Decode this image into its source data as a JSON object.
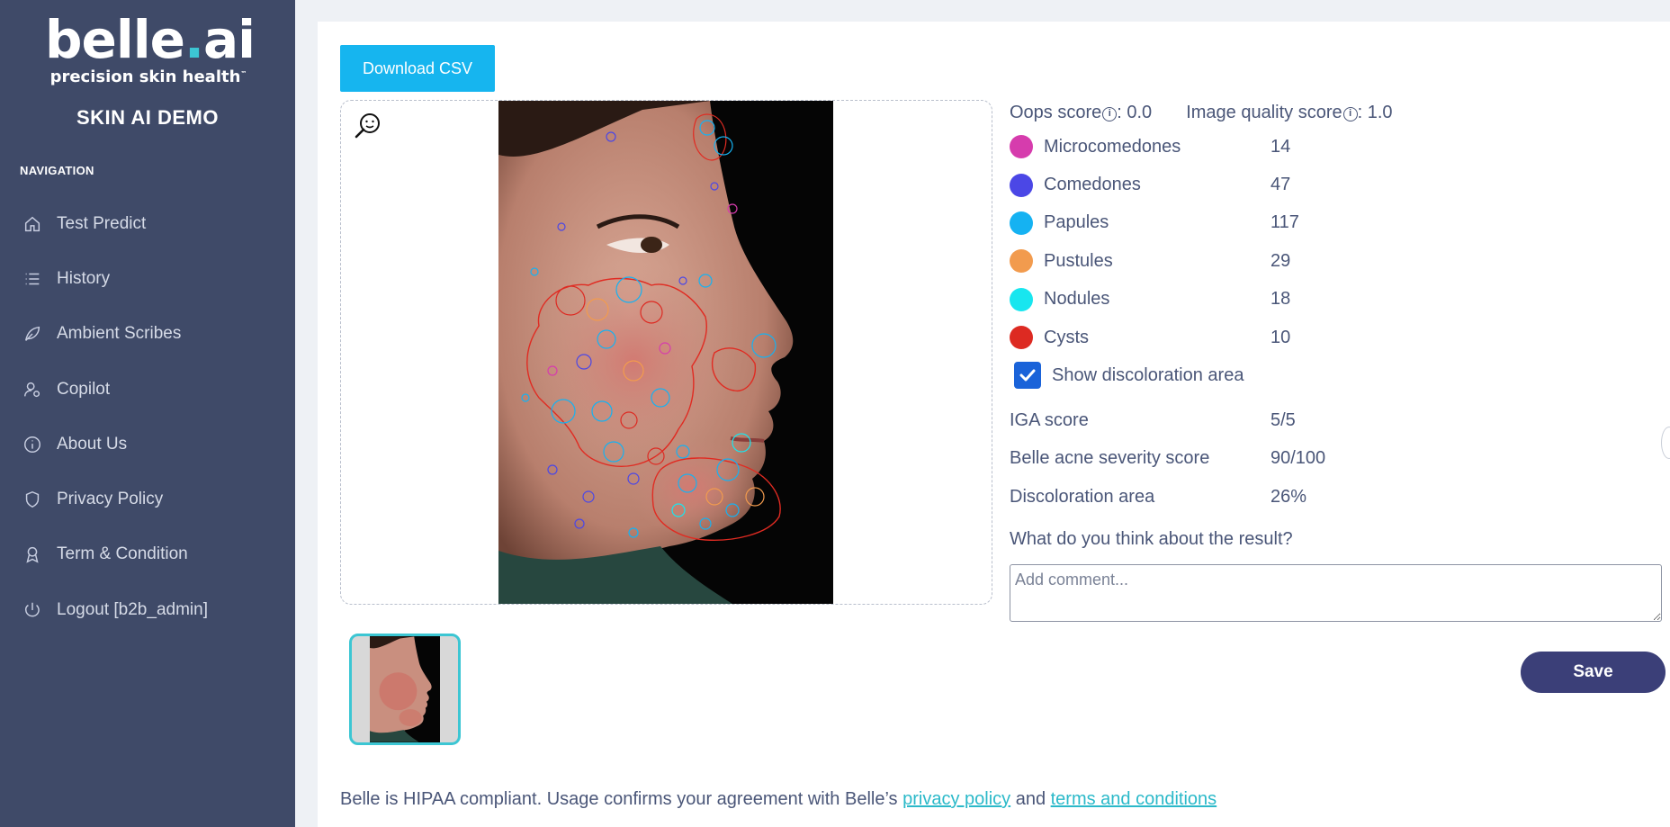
{
  "brand": {
    "logo_main": "belle",
    "logo_dot": ".",
    "logo_tld": "ai",
    "tagline": "precision skin health",
    "tm": "™",
    "app_title": "SKIN AI DEMO"
  },
  "sidebar": {
    "heading": "NAVIGATION",
    "items": [
      {
        "label": "Test Predict",
        "icon": "home-icon"
      },
      {
        "label": "History",
        "icon": "list-icon"
      },
      {
        "label": "Ambient Scribes",
        "icon": "leaf-icon"
      },
      {
        "label": "Copilot",
        "icon": "user-gear-icon"
      },
      {
        "label": "About Us",
        "icon": "info-circle-icon"
      },
      {
        "label": "Privacy Policy",
        "icon": "shield-icon"
      },
      {
        "label": "Term & Condition",
        "icon": "award-icon"
      },
      {
        "label": "Logout [b2b_admin]",
        "icon": "power-icon"
      }
    ]
  },
  "toolbar": {
    "download_label": "Download CSV"
  },
  "scores": {
    "oops_label": "Oops score",
    "oops_value": ": 0.0",
    "quality_label": "Image quality score",
    "quality_value": ": 1.0",
    "info_glyph": "i"
  },
  "lesions": [
    {
      "name": "Microcomedones",
      "count": "14",
      "color": "#d63cad"
    },
    {
      "name": "Comedones",
      "count": "47",
      "color": "#4b47e6"
    },
    {
      "name": "Papules",
      "count": "117",
      "color": "#15b2f2"
    },
    {
      "name": "Pustules",
      "count": "29",
      "color": "#f29b4e"
    },
    {
      "name": "Nodules",
      "count": "18",
      "color": "#18e6ef"
    },
    {
      "name": "Cysts",
      "count": "10",
      "color": "#dd2a22"
    }
  ],
  "discoloration_toggle": {
    "label": "Show discoloration area",
    "checked": true
  },
  "stats": [
    {
      "label": "IGA score",
      "value": "5/5"
    },
    {
      "label": "Belle acne severity score",
      "value": "90/100"
    },
    {
      "label": "Discoloration area",
      "value": "26%"
    }
  ],
  "feedback": {
    "question": "What do you think about the result?",
    "placeholder": "Add comment...",
    "save_label": "Save"
  },
  "footer": {
    "text_before": "Belle is HIPAA compliant. Usage confirms your agreement with Belle’s ",
    "privacy_link": "privacy policy",
    "text_middle": " and ",
    "terms_link": "terms and conditions"
  },
  "colors": {
    "sidebar_bg": "#3f4a68",
    "accent_teal": "#3cc6d3",
    "csv_button": "#16b5ef",
    "save_button": "#3b3f78",
    "checkbox": "#1a63d9"
  }
}
